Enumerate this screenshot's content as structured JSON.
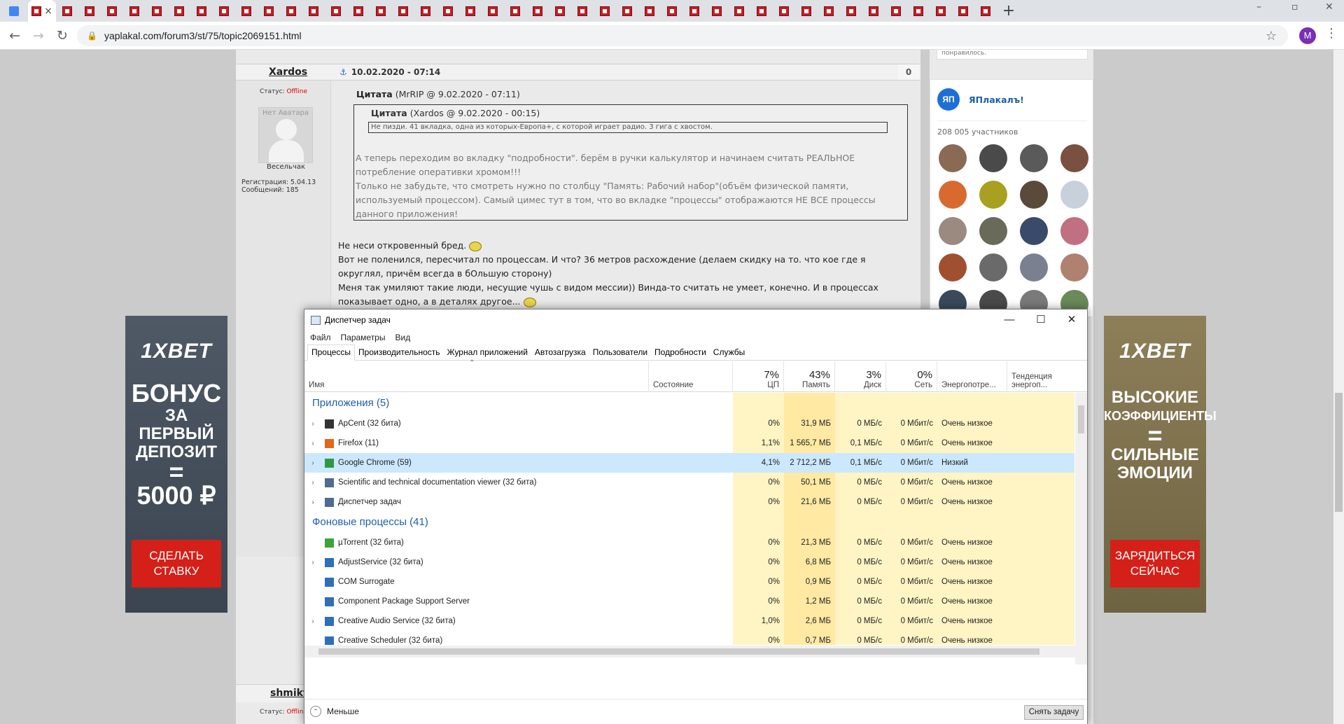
{
  "browser": {
    "tab_count": 42,
    "active_tab_close": "×",
    "new_tab": "+",
    "url": "yaplakal.com/forum3/st/75/topic2069151.html",
    "profile_initial": "M",
    "window_controls": {
      "minimize": "–",
      "maximize": "▫",
      "close": "✕"
    }
  },
  "forum": {
    "post": {
      "author": "Xardos",
      "date": "10.02.2020 - 07:14",
      "score": "0",
      "status_label": "Статус: ",
      "status_value": "Offline",
      "avatar_text": "Нет Аватара",
      "rank": "Весельчак",
      "registration": "Регистрация: 5.04.13",
      "messages": "Сообщений: 185",
      "quote_outer_title": "Цитата",
      "quote_outer_meta": "(MrRIP @ 9.02.2020 - 07:11)",
      "quote_inner_title": "Цитата",
      "quote_inner_meta": "(Xardos @ 9.02.2020 - 00:15)",
      "quote_inner_text": "Не пизди. 41 вкладка, одна из которых-Европа+, с которой играет радио. 3 гига с хвостом.",
      "quote_outer_text": "А теперь переходим во вкладку \"подробности\". берём в ручки калькулятор и начинаем считать РЕАЛЬНОЕ потребление оперативки хромом!!!\nТолько не забудьте, что смотреть нужно по столбцу \"Память: Рабочий набор\"(объём физической памяти, используемый процессом). Самый цимес тут в том, что во вкладке \"процессы\" отображаются НЕ ВСЕ процессы данного приложения!",
      "body_line1": "Не неси откровенный бред.",
      "body_line2": "Вот не поленился, пересчитал по процессам. И что? 36 метров расхождение (делаем скидку на то. что кое где я округлял, причём всегда в бОльшую сторону)",
      "body_line3": "Меня так умиляют такие люди, несущие чушь с видом мессии)) Винда-то считать не умеет, конечно. И в процессах показывает одно, а в деталях другое..."
    },
    "next_post": {
      "author": "shmikt",
      "status_label": "Статус: ",
      "status_value": "Offline"
    }
  },
  "sidebar": {
    "top_text": "понравилось.",
    "group_logo": "ЯП",
    "group_name": "ЯПлакалъ!",
    "members": "208 005 участников",
    "member_colors": [
      "#8a6a55",
      "#4a4a4a",
      "#5a5a5a",
      "#7a5040",
      "#d86a30",
      "#a8a020",
      "#5a4a3a",
      "#c8d0dc",
      "#9a8a80",
      "#6a6a5a",
      "#3a4a6a",
      "#c07080",
      "#a05030",
      "#6a6a6a",
      "#7a8090",
      "#b08070",
      "#3a4a5a",
      "#4a4a4a",
      "#7a7a7a",
      "#6a8a5a"
    ]
  },
  "ads": {
    "left": {
      "logo": "1XBET",
      "l1": "БОНУС",
      "l2": "ЗА ПЕРВЫЙ",
      "l3": "ДЕПОЗИТ",
      "l4": "=",
      "l5": "5000 ₽",
      "button": "СДЕЛАТЬ СТАВКУ"
    },
    "right": {
      "logo": "1XBET",
      "l1": "ВЫСОКИЕ",
      "l2": "КОЭФФИЦИЕНТЫ",
      "l3": "=",
      "l4": "СИЛЬНЫЕ",
      "l5": "ЭМОЦИИ",
      "button": "ЗАРЯДИТЬСЯ СЕЙЧАС"
    }
  },
  "taskmgr": {
    "title": "Диспетчер задач",
    "controls": {
      "minimize": "—",
      "maximize": "☐",
      "close": "✕"
    },
    "menu": [
      "Файл",
      "Параметры",
      "Вид"
    ],
    "tabs": [
      "Процессы",
      "Производительность",
      "Журнал приложений",
      "Автозагрузка",
      "Пользователи",
      "Подробности",
      "Службы"
    ],
    "active_tab": 0,
    "columns": {
      "name": "Имя",
      "status": "Состояние",
      "cpu": {
        "pct": "7%",
        "label": "ЦП"
      },
      "mem": {
        "pct": "43%",
        "label": "Память"
      },
      "disk": {
        "pct": "3%",
        "label": "Диск"
      },
      "net": {
        "pct": "0%",
        "label": "Сеть"
      },
      "power": "Энергопотре...",
      "power_trend": "Тенденция энергоп..."
    },
    "groups": [
      {
        "title": "Приложения (5)",
        "rows": [
          {
            "name": "ApCent (32 бита)",
            "cpu": "0%",
            "mem": "31,9 МБ",
            "disk": "0 МБ/с",
            "net": "0 Мбит/с",
            "power": "Очень низкое",
            "expand": true,
            "icon": "apcent-icon",
            "color": "#333"
          },
          {
            "name": "Firefox (11)",
            "cpu": "1,1%",
            "mem": "1 565,7 МБ",
            "disk": "0,1 МБ/с",
            "net": "0 Мбит/с",
            "power": "Очень низкое",
            "expand": true,
            "icon": "firefox-icon",
            "color": "#e2661b"
          },
          {
            "name": "Google Chrome (59)",
            "cpu": "4,1%",
            "mem": "2 712,2 МБ",
            "disk": "0,1 МБ/с",
            "net": "0 Мбит/с",
            "power": "Низкий",
            "expand": true,
            "icon": "chrome-icon",
            "color": "#2c9a44",
            "selected": true
          },
          {
            "name": "Scientific and technical documentation viewer (32 бита)",
            "cpu": "0%",
            "mem": "50,1 МБ",
            "disk": "0 МБ/с",
            "net": "0 Мбит/с",
            "power": "Очень низкое",
            "expand": true,
            "icon": "viewer-icon",
            "color": "#4d6c90"
          },
          {
            "name": "Диспетчер задач",
            "cpu": "0%",
            "mem": "21,6 МБ",
            "disk": "0 МБ/с",
            "net": "0 Мбит/с",
            "power": "Очень низкое",
            "expand": true,
            "icon": "taskmgr-icon",
            "color": "#4d6c90"
          }
        ]
      },
      {
        "title": "Фоновые процессы (41)",
        "rows": [
          {
            "name": "µTorrent (32 бита)",
            "cpu": "0%",
            "mem": "21,3 МБ",
            "disk": "0 МБ/с",
            "net": "0 Мбит/с",
            "power": "Очень низкое",
            "expand": false,
            "icon": "utorrent-icon",
            "color": "#3aa53a"
          },
          {
            "name": "AdjustService (32 бита)",
            "cpu": "0%",
            "mem": "6,8 МБ",
            "disk": "0 МБ/с",
            "net": "0 Мбит/с",
            "power": "Очень низкое",
            "expand": true,
            "icon": "service-icon",
            "color": "#2e6fb8"
          },
          {
            "name": "COM Surrogate",
            "cpu": "0%",
            "mem": "0,9 МБ",
            "disk": "0 МБ/с",
            "net": "0 Мбит/с",
            "power": "Очень низкое",
            "expand": false,
            "icon": "service-icon",
            "color": "#2e6fb8"
          },
          {
            "name": "Component Package Support Server",
            "cpu": "0%",
            "mem": "1,2 МБ",
            "disk": "0 МБ/с",
            "net": "0 Мбит/с",
            "power": "Очень низкое",
            "expand": false,
            "icon": "service-icon",
            "color": "#2e6fb8"
          },
          {
            "name": "Creative Audio Service (32 бита)",
            "cpu": "1,0%",
            "mem": "2,6 МБ",
            "disk": "0 МБ/с",
            "net": "0 Мбит/с",
            "power": "Очень низкое",
            "expand": true,
            "icon": "service-icon",
            "color": "#2e6fb8"
          },
          {
            "name": "Creative Scheduler (32 бита)",
            "cpu": "0%",
            "mem": "0,7 МБ",
            "disk": "0 МБ/с",
            "net": "0 Мбит/с",
            "power": "Очень низкое",
            "expand": false,
            "icon": "service-icon",
            "color": "#2e6fb8"
          }
        ]
      }
    ],
    "less_button": "Меньше",
    "end_task_button": "Снять задачу"
  }
}
